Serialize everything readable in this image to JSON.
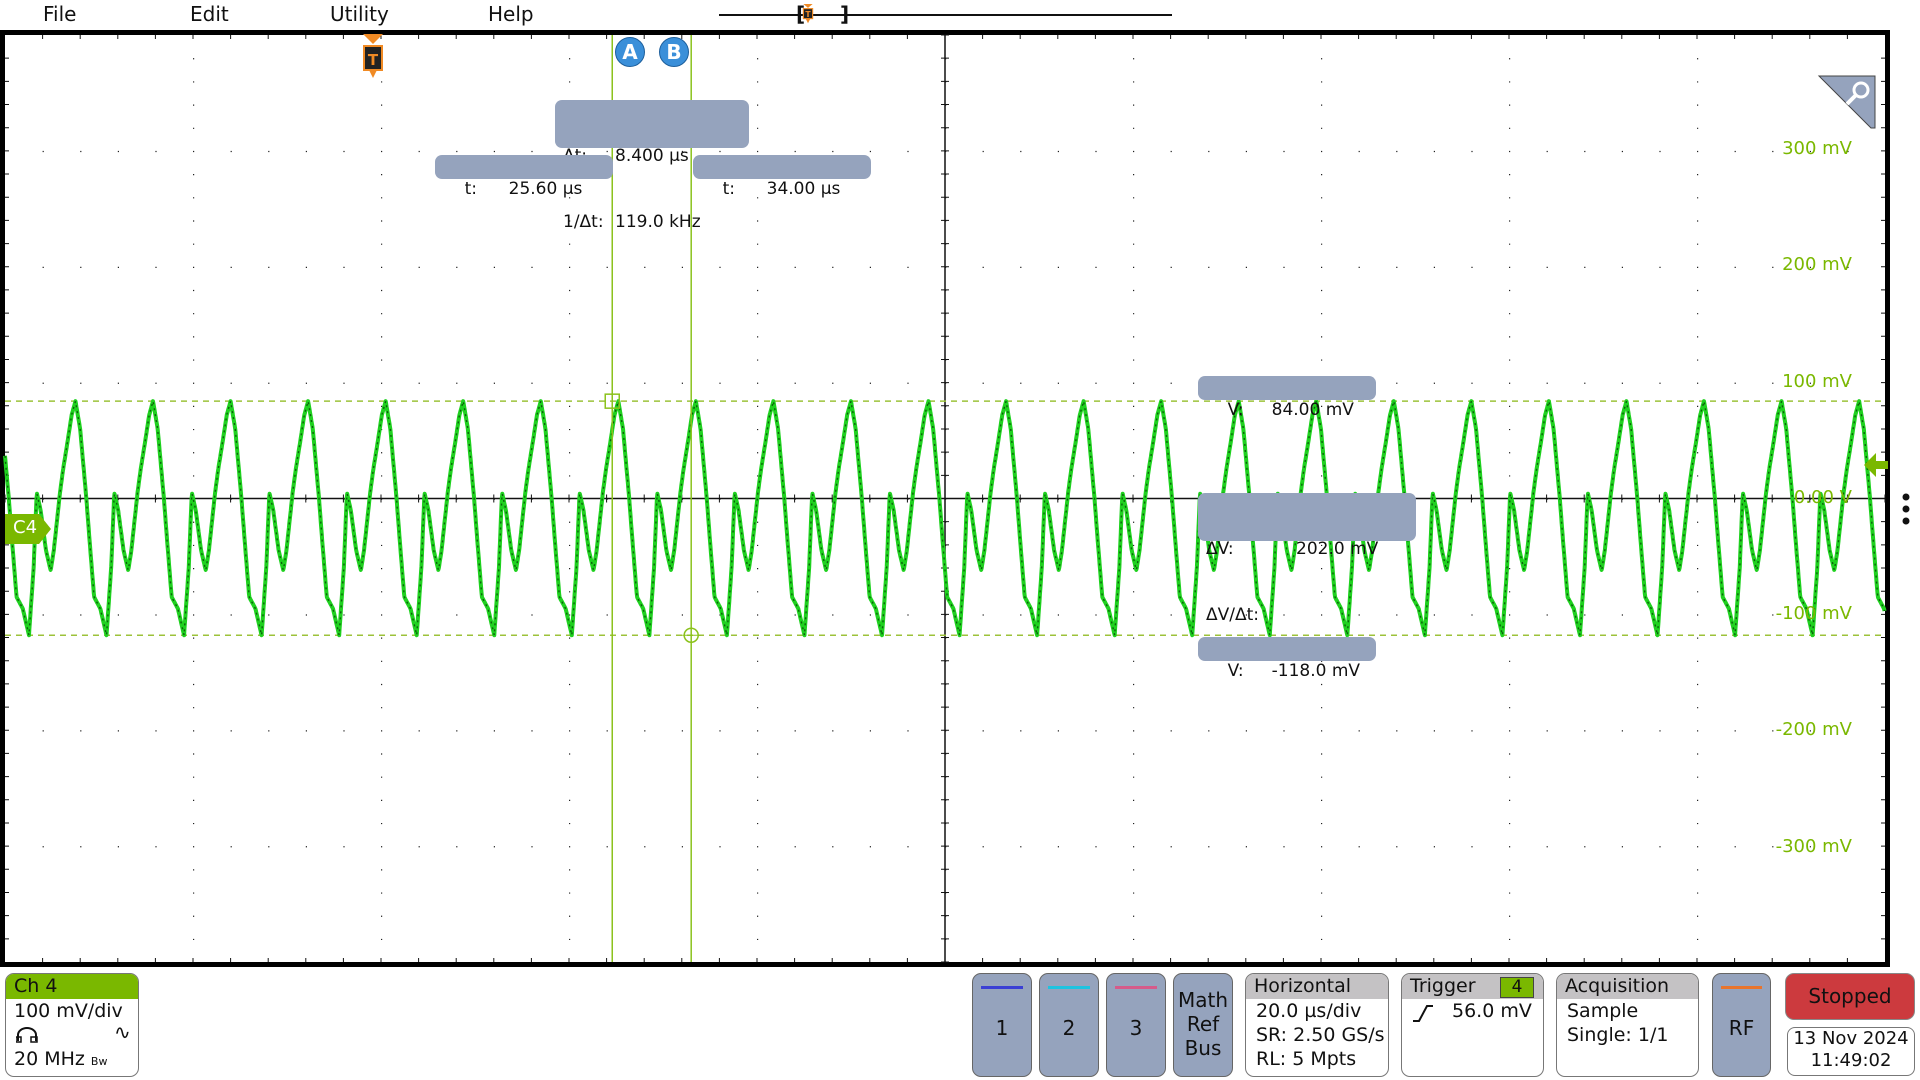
{
  "menu": {
    "items": [
      {
        "label": "File"
      },
      {
        "label": "Edit"
      },
      {
        "label": "Utility"
      },
      {
        "label": "Help"
      }
    ]
  },
  "timeline": {
    "open_bracket": "[",
    "close_bracket": "]",
    "trigger_icon": "trigger-T-icon"
  },
  "colors": {
    "channel4": "#7ab800",
    "trace": "#1fd11f",
    "trigger": "#f08a24",
    "cursor_badge": "#3a8fd9",
    "measurement_box": "#95a3bd",
    "stopped": "#cc3a3e",
    "ch1": "#3b3fd4",
    "ch2": "#1ec3e0",
    "ch3": "#d65b8a",
    "rf": "#e8742c"
  },
  "graticule": {
    "h_divisions": 10,
    "v_divisions": 8,
    "volts_per_div_mV": 100,
    "time_per_div_us": 20,
    "trigger_time_us": 0,
    "time_left_us": -39.0,
    "voltage_labels": [
      "300 mV",
      "200 mV",
      "100 mV",
      "0.00 V",
      "-100 mV",
      "-200 mV",
      "-300 mV"
    ],
    "voltage_label_values_mV": [
      300,
      200,
      100,
      0,
      -100,
      -200,
      -300
    ]
  },
  "trigger_marker": {
    "label": "T"
  },
  "trigger_level_mV": 56.0,
  "channel_tag": {
    "label": "C4"
  },
  "cursors": {
    "a": {
      "badge": "A",
      "time_us": 25.6,
      "time_label": "t:",
      "time_value": "25.60 µs"
    },
    "b": {
      "badge": "B",
      "time_us": 34.0,
      "time_label": "t:",
      "time_value": "34.00 µs"
    },
    "delta": {
      "dt_label": "Δt:",
      "dt_value": "8.400 µs",
      "inv_label": "1/Δt:",
      "inv_value": "119.0 kHz"
    },
    "v_top": {
      "label": "V:",
      "value": "84.00 mV",
      "value_mV": 84.0
    },
    "v_bottom": {
      "label": "V:",
      "value": "-118.0 mV",
      "value_mV": -118.0
    },
    "dv": {
      "label": "ΔV:",
      "value": "202.0 mV",
      "slope_label": "ΔV/Δt:",
      "slope_value": ""
    }
  },
  "waveform": {
    "period_us": 8.25,
    "first_peak_time_us": -31.5,
    "shape_phase": [
      0.0,
      0.06,
      0.1,
      0.14,
      0.18,
      0.24,
      0.32,
      0.4,
      0.46,
      0.5,
      0.55,
      0.62,
      0.68,
      0.72,
      0.76,
      0.8,
      0.84,
      0.9,
      0.95,
      1.0
    ],
    "shape_mV": [
      84,
      60,
      30,
      0,
      -35,
      -85,
      -95,
      -118,
      -60,
      5,
      -10,
      -45,
      -62,
      -45,
      -20,
      5,
      25,
      50,
      72,
      84
    ]
  },
  "bottom_bar": {
    "ch4": {
      "title": "Ch 4",
      "scale": "100 mV/div",
      "bandwidth": "20 MHz",
      "bw_symbol": "Bw"
    },
    "channel_buttons": [
      {
        "label": "1"
      },
      {
        "label": "2"
      },
      {
        "label": "3"
      }
    ],
    "math_ref_bus": {
      "line1": "Math",
      "line2": "Ref",
      "line3": "Bus"
    },
    "horizontal": {
      "title": "Horizontal",
      "scale": "20.0 µs/div",
      "sr": "SR: 2.50 GS/s",
      "rl": "RL: 5 Mpts"
    },
    "trigger": {
      "title": "Trigger",
      "source": "4",
      "level": "56.0 mV"
    },
    "acquisition": {
      "title": "Acquisition",
      "mode": "Sample",
      "count": "Single: 1/1"
    },
    "rf": {
      "label": "RF"
    },
    "status": {
      "label": "Stopped"
    },
    "date": "13 Nov 2024",
    "time": "11:49:02"
  }
}
